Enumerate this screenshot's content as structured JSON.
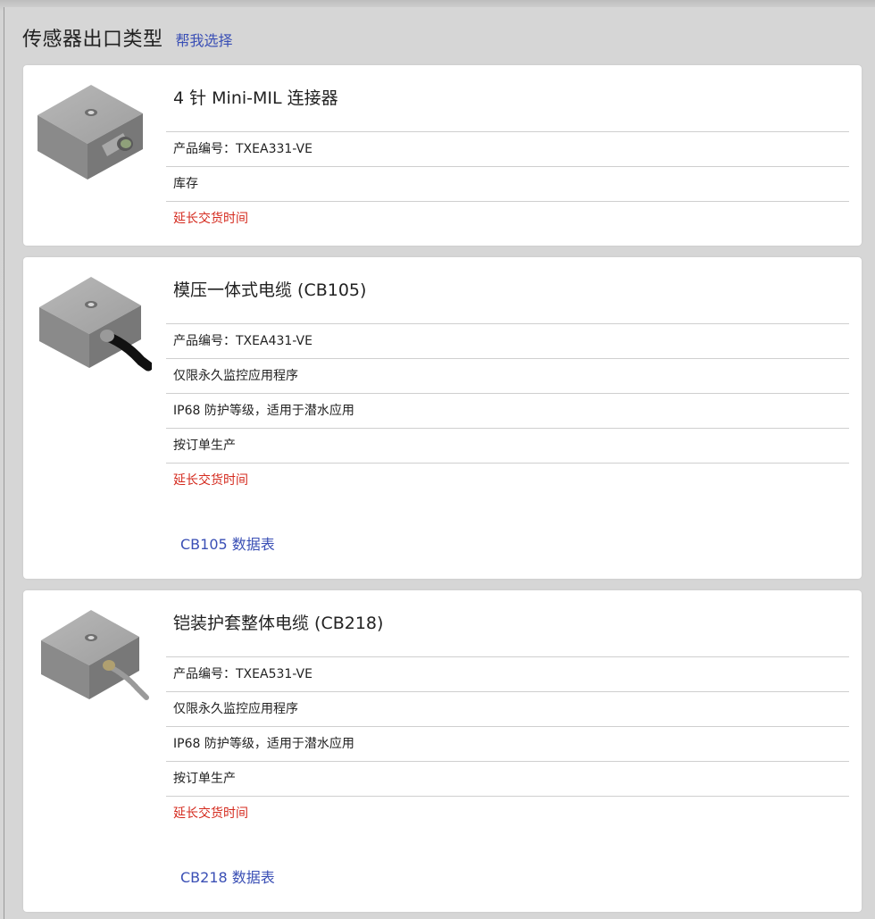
{
  "header": {
    "title": "传感器出口类型",
    "help_link": "帮我选择"
  },
  "products": [
    {
      "title": "4 针 Mini-MIL 连接器",
      "image_icon": "sensor-connector-image",
      "rows": [
        "产品编号：TXEA331-VE",
        "库存"
      ],
      "delivery": "延长交货时间",
      "datasheet": null
    },
    {
      "title": "模压一体式电缆 (CB105)",
      "image_icon": "sensor-molded-cable-image",
      "rows": [
        "产品编号：TXEA431-VE",
        "仅限永久监控应用程序",
        "IP68 防护等级，适用于潜水应用",
        "按订单生产"
      ],
      "delivery": "延长交货时间",
      "datasheet": "CB105 数据表"
    },
    {
      "title": "铠装护套整体电缆 (CB218)",
      "image_icon": "sensor-armored-cable-image",
      "rows": [
        "产品编号：TXEA531-VE",
        "仅限永久监控应用程序",
        "IP68 防护等级，适用于潜水应用",
        "按订单生产"
      ],
      "delivery": "延长交货时间",
      "datasheet": "CB218 数据表"
    }
  ],
  "colors": {
    "link": "#3a4fb5",
    "delivery_warning": "#d42a1e",
    "background": "#d6d6d6",
    "card": "#ffffff"
  }
}
